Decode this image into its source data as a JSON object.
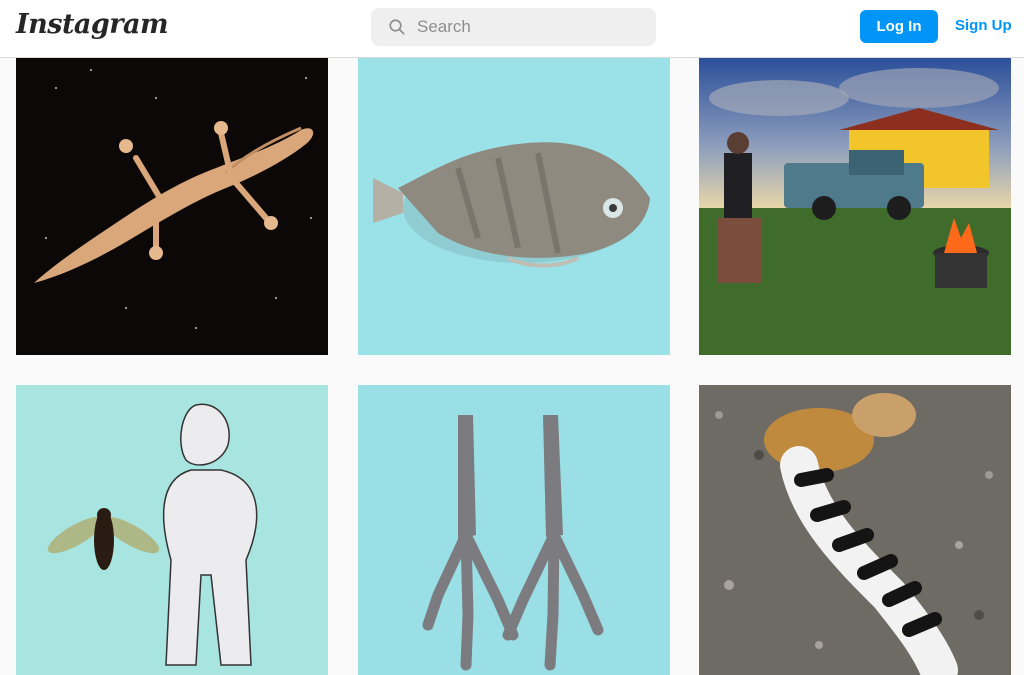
{
  "header": {
    "logo_text": "Instagram",
    "search_placeholder": "Search",
    "login_label": "Log In",
    "signup_label": "Sign Up"
  },
  "posts": [
    {
      "subject": "gecko",
      "background": "#0b0807"
    },
    {
      "subject": "dried fish",
      "background": "#9be2e8"
    },
    {
      "subject": "woman, truck and fire",
      "background": "#566a8e"
    },
    {
      "subject": "wasp and paper figure",
      "background": "#a8e5e0"
    },
    {
      "subject": "bird feet",
      "background": "#9adfe6"
    },
    {
      "subject": "ringtail on gravel",
      "background": "#6e6a64"
    }
  ],
  "colors": {
    "accent": "#0095f6",
    "page_background": "#fafafa",
    "header_border": "#dbdbdb"
  }
}
